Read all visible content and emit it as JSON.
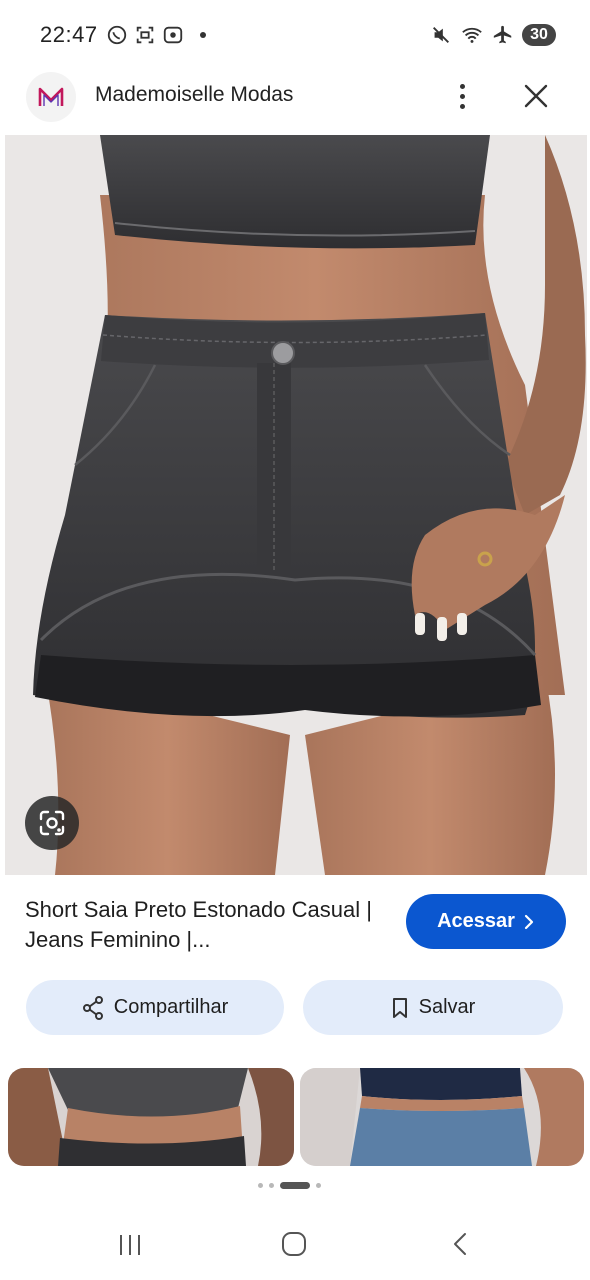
{
  "status_bar": {
    "time": "22:47",
    "battery_level": "30",
    "icons": [
      "whatsapp-icon",
      "screenshot-icon",
      "record-icon",
      "mute-icon",
      "wifi-icon",
      "airplane-icon",
      "battery-icon"
    ]
  },
  "header": {
    "site_name": "Mademoiselle Modas",
    "logo_letter": "M",
    "brand_color": "#c2185b"
  },
  "product": {
    "title": "Short Saia Preto Estonado Casual | Jeans Feminino |..."
  },
  "actions": {
    "visit_label": "Acessar",
    "share_label": "Compartilhar",
    "save_label": "Salvar",
    "accent_color": "#0b57d0"
  },
  "carousel": {
    "page_count": 4,
    "active_index": 2
  }
}
